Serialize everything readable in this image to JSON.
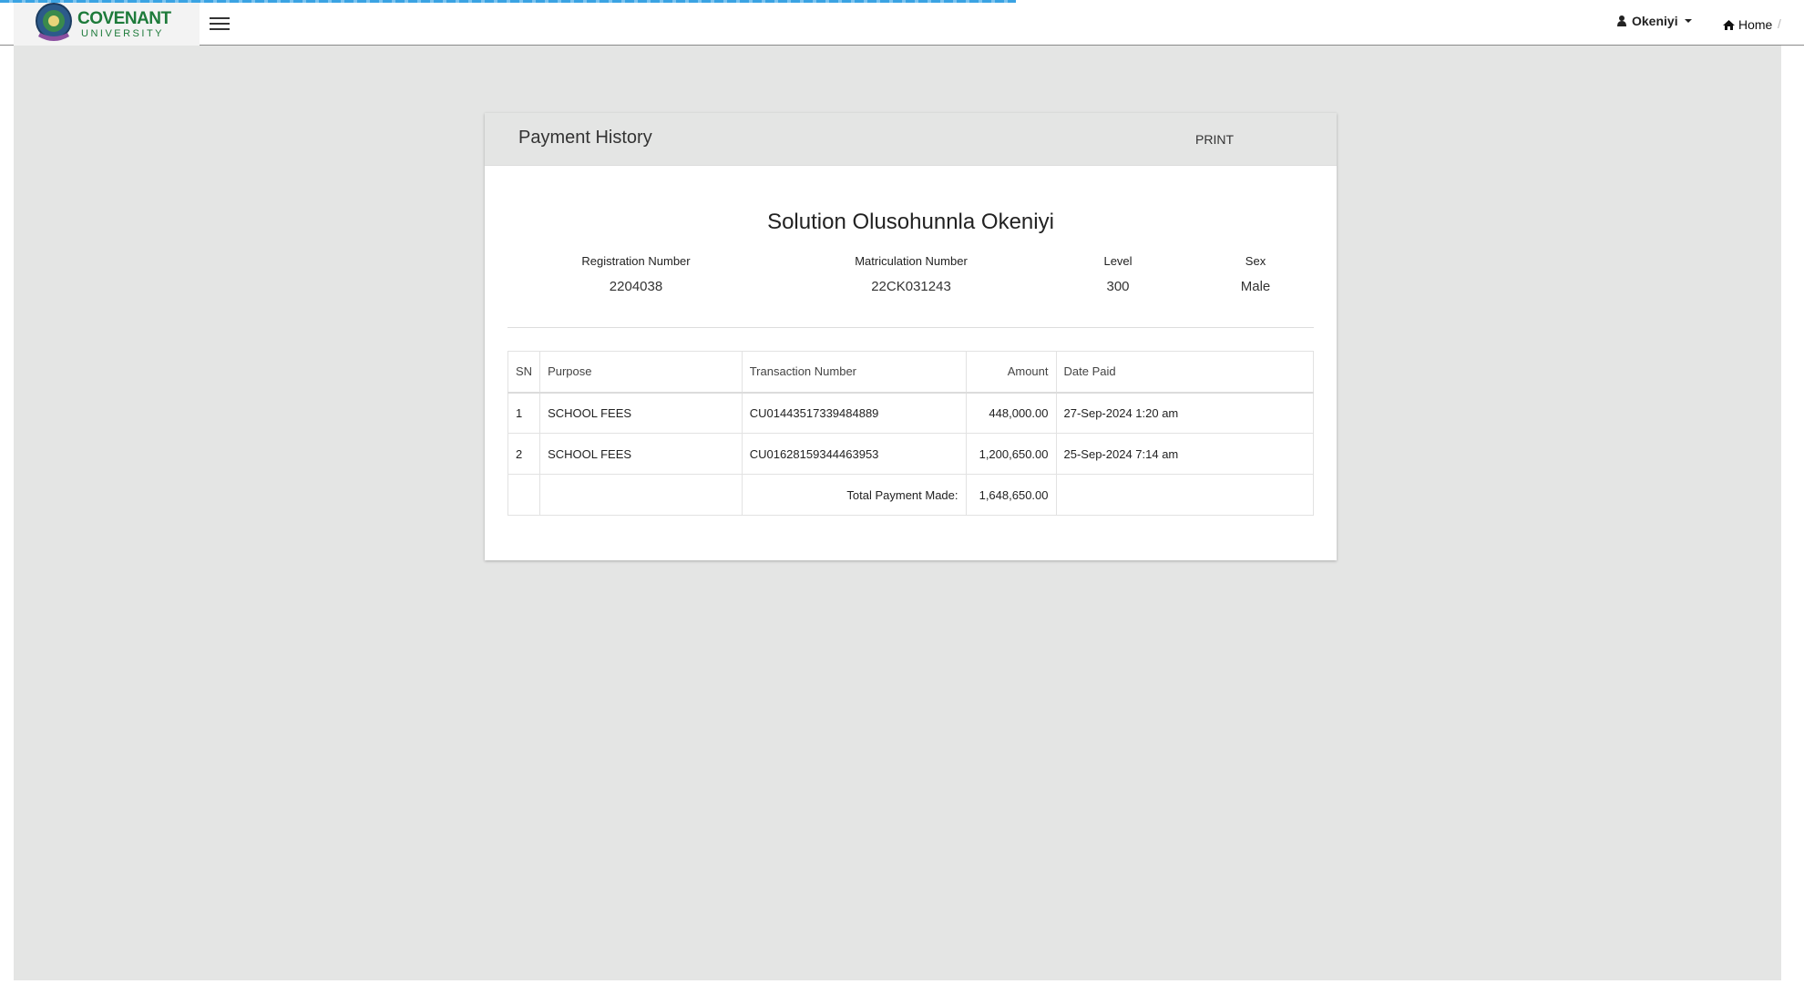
{
  "header": {
    "logo_main": "COVENANT",
    "logo_sub": "UNIVERSITY",
    "user_name": "Okeniyi",
    "home_label": "Home",
    "breadcrumb_sep": "/"
  },
  "card": {
    "title": "Payment History",
    "print_label": "PRINT"
  },
  "student": {
    "name": "Solution Olusohunnla Okeniyi",
    "fields": [
      {
        "label": "Registration Number",
        "value": "2204038"
      },
      {
        "label": "Matriculation Number",
        "value": "22CK031243"
      },
      {
        "label": "Level",
        "value": "300"
      },
      {
        "label": "Sex",
        "value": "Male"
      }
    ]
  },
  "table": {
    "headers": [
      "SN",
      "Purpose",
      "Transaction Number",
      "Amount",
      "Date Paid"
    ],
    "rows": [
      {
        "sn": "1",
        "purpose": "SCHOOL FEES",
        "txn": "CU01443517339484889",
        "amount": "448,000.00",
        "date": "27-Sep-2024 1:20 am"
      },
      {
        "sn": "2",
        "purpose": "SCHOOL FEES",
        "txn": "CU01628159344463953",
        "amount": "1,200,650.00",
        "date": "25-Sep-2024 7:14 am"
      }
    ],
    "total_label": "Total Payment Made:",
    "total_amount": "1,648,650.00"
  },
  "colors": {
    "brand_green": "#1d7a3a",
    "page_gray": "#e4e5e4",
    "loading_bar": "#3aa3e3"
  },
  "icons": [
    "hamburger-icon",
    "user-icon",
    "home-icon",
    "caret-down-icon"
  ]
}
